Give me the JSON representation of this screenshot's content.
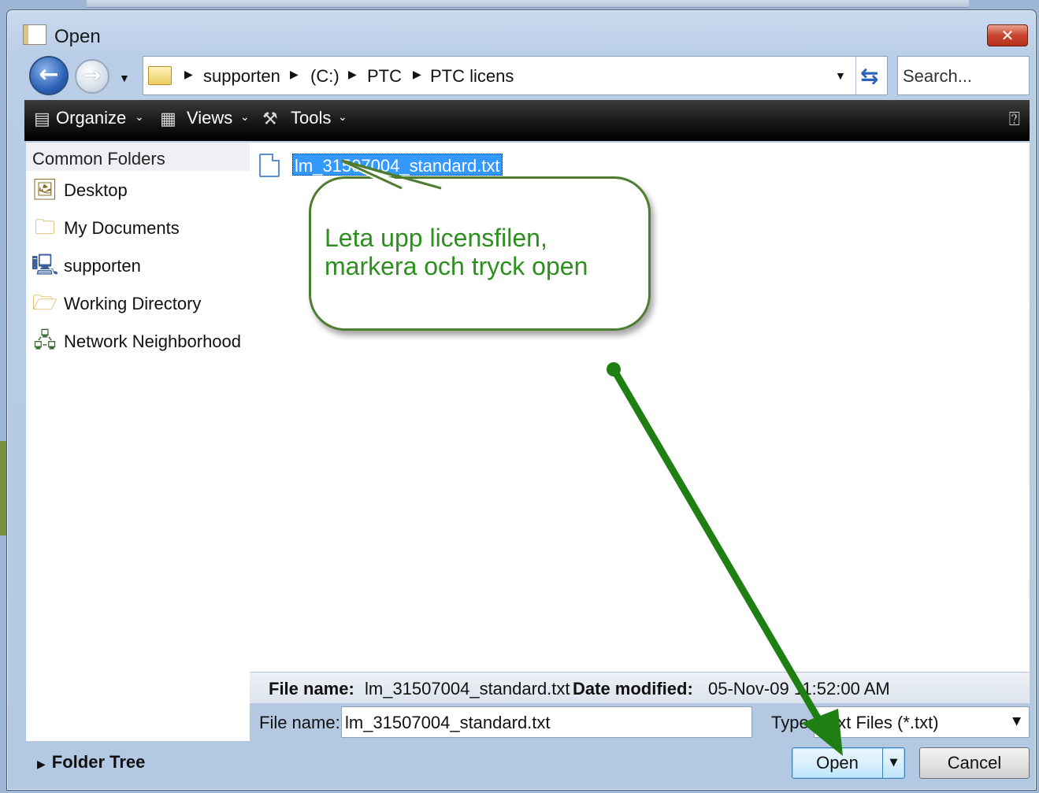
{
  "window": {
    "title": "Open"
  },
  "nav": {
    "breadcrumbs": [
      "supporten",
      "(C:)",
      "PTC",
      "PTC licens"
    ],
    "search_placeholder": "Search..."
  },
  "toolbar": {
    "organize": "Organize",
    "views": "Views",
    "tools": "Tools"
  },
  "sidebar": {
    "header": "Common Folders",
    "items": [
      {
        "label": "Desktop",
        "icon": "desktop-icon"
      },
      {
        "label": "My Documents",
        "icon": "documents-icon"
      },
      {
        "label": "supporten",
        "icon": "computer-icon"
      },
      {
        "label": "Working Directory",
        "icon": "working-directory-icon"
      },
      {
        "label": "Network Neighborhood",
        "icon": "network-icon"
      }
    ]
  },
  "files": [
    {
      "name": "lm_31507004_standard.txt",
      "selected": true
    }
  ],
  "info": {
    "file_name_label": "File name:",
    "file_name_value": "lm_31507004_standard.txt",
    "date_label": "Date modified:",
    "date_value": "05-Nov-09 11:52:00 AM"
  },
  "bottom": {
    "file_name_label": "File name:",
    "file_name_value": "lm_31507004_standard.txt",
    "type_label": "Type",
    "type_value": "Text Files (*.txt)",
    "folder_tree": "Folder Tree",
    "open": "Open",
    "cancel": "Cancel"
  },
  "annotation": {
    "text": "Leta upp licensfilen, markera och tryck open"
  },
  "colors": {
    "accent": "#3399ff",
    "annotation": "#2d8f1f",
    "arrow": "#1f7f12",
    "close": "#c8452e"
  }
}
